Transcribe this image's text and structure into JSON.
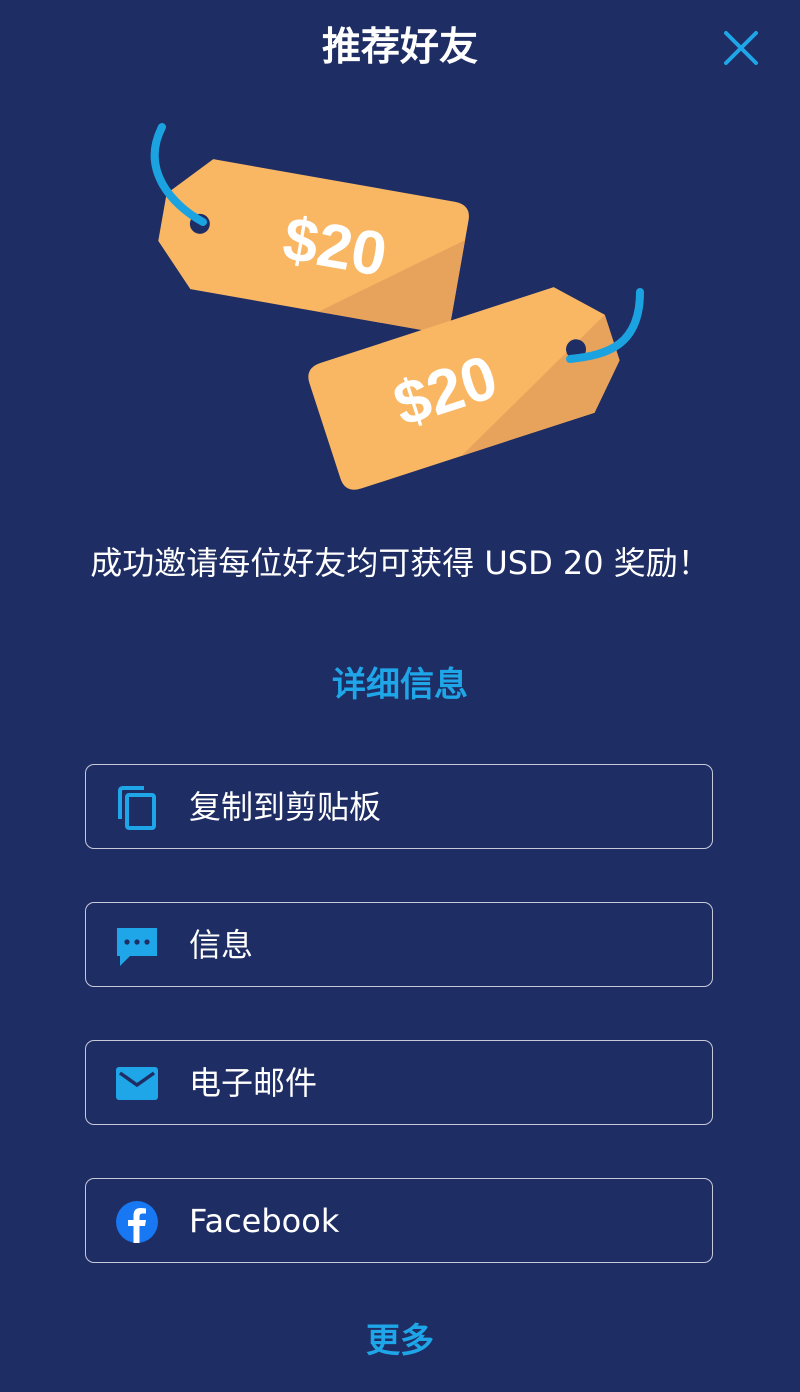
{
  "header": {
    "title": "推荐好友"
  },
  "hero": {
    "tag_top_text": "$20",
    "tag_bottom_text": "$20"
  },
  "description": "成功邀请每位好友均可获得 USD 20 奖励！",
  "details_link": "详细信息",
  "share_options": [
    {
      "label": "复制到剪贴板",
      "icon": "copy-icon"
    },
    {
      "label": "信息",
      "icon": "message-icon"
    },
    {
      "label": "电子邮件",
      "icon": "mail-icon"
    },
    {
      "label": "Facebook",
      "icon": "facebook-icon"
    }
  ],
  "more_link": "更多",
  "colors": {
    "background": "#1e2d63",
    "accent": "#1fa6e8",
    "tag": "#f9b764",
    "tag_shadow": "#e7a25c",
    "string": "#1aa3e0",
    "facebook": "#1877f2"
  }
}
